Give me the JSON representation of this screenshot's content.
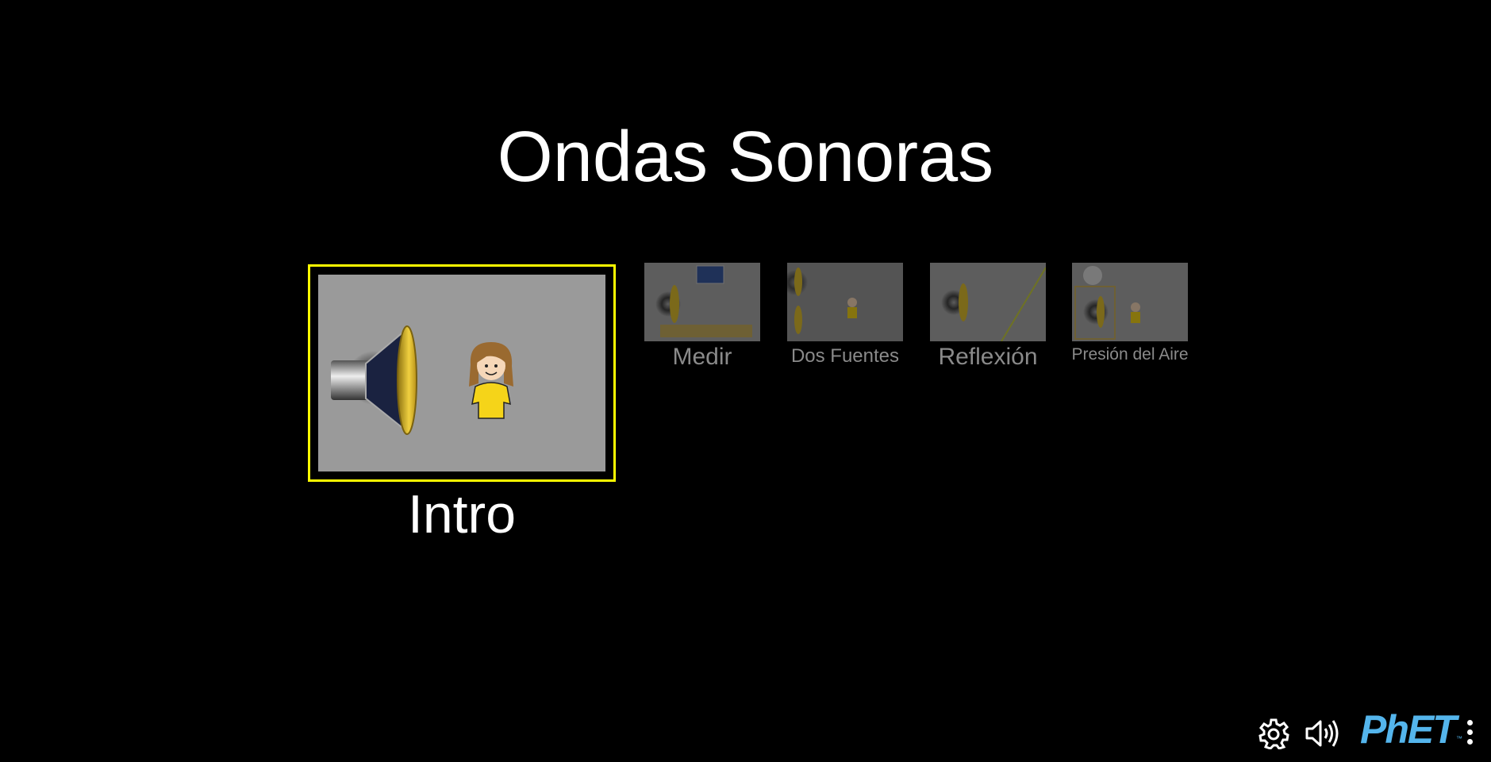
{
  "sim": {
    "title": "Ondas Sonoras"
  },
  "screens": [
    {
      "label": "Intro",
      "selected": true
    },
    {
      "label": "Medir",
      "selected": false
    },
    {
      "label": "Dos Fuentes",
      "selected": false
    },
    {
      "label": "Reflexión",
      "selected": false
    },
    {
      "label": "Presión del Aire",
      "selected": false
    }
  ],
  "navbar": {
    "settings_icon": "gear-icon",
    "sound_icon": "speaker-icon",
    "logo_text": "PhET",
    "logo_tm": "™",
    "menu_icon": "kebab-menu-icon"
  },
  "colors": {
    "background": "#000000",
    "selected_border": "#ffff00",
    "logo": "#54b5ec",
    "inactive_label": "#8a8a8a",
    "speaker_cone": "#d4b020",
    "shirt": "#f5d419"
  }
}
